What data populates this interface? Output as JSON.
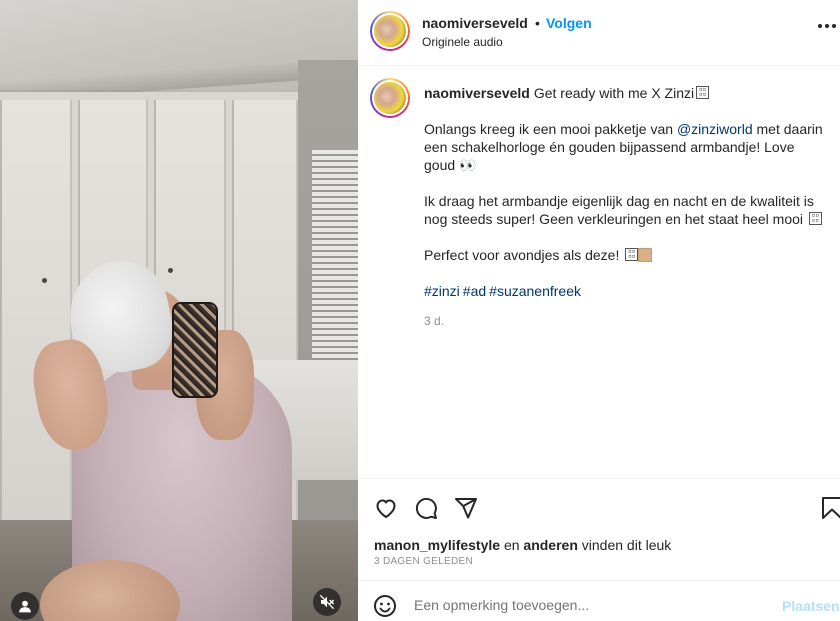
{
  "post": {
    "username": "naomiverseveld",
    "dot": "•",
    "follow_label": "Volgen",
    "audio": "Originele audio"
  },
  "caption": {
    "username": "naomiverseveld",
    "title": "Get ready with me X Zinzi",
    "para1_a": "Onlangs kreeg ik een mooi pakketje van",
    "mention": "@zinziworld",
    "para1_b": "met daarin een schakelhorloge én gouden bijpassend armbandje! Love goud",
    "para1_emoji": "👀",
    "para2": "Ik draag het armbandje eigenlijk dag en nacht en de kwaliteit is nog steeds super! Geen verkleuringen en het staat heel mooi",
    "para3": "Perfect voor avondjes als deze!",
    "hashtags": [
      "#zinzi",
      "#ad",
      "#suzanenfreek"
    ],
    "time": "3 d."
  },
  "likes": {
    "user": "manon_mylifestyle",
    "connector": "en",
    "others": "anderen",
    "suffix": "vinden dit leuk"
  },
  "date": "3 DAGEN GELEDEN",
  "comment": {
    "placeholder": "Een opmerking toevoegen...",
    "post_label": "Plaatsen"
  },
  "icons": {
    "heart": "heart-icon",
    "comment": "comment-icon",
    "share": "share-icon",
    "save": "bookmark-icon",
    "emoji": "emoji-icon",
    "user": "user-icon",
    "mute": "muted-icon",
    "more": "more-icon"
  },
  "colors": {
    "accent": "#0095f6",
    "link": "#00376b",
    "muted": "#8e8e8e",
    "post_disabled": "#b2dffc"
  }
}
